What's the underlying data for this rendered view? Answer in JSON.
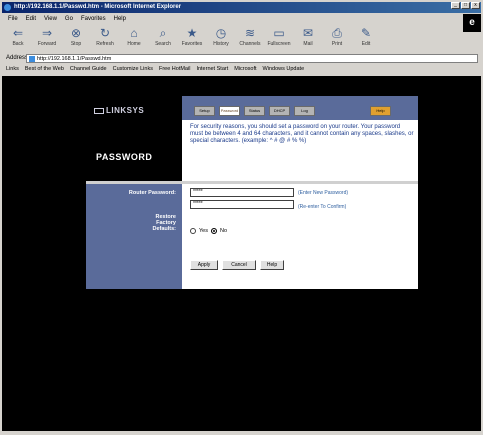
{
  "window": {
    "title": "http://192.168.1.1/Passwd.htm - Microsoft Internet Explorer",
    "controls": [
      "_",
      "□",
      "x"
    ]
  },
  "menu": [
    "File",
    "Edit",
    "View",
    "Go",
    "Favorites",
    "Help"
  ],
  "toolbar": [
    {
      "label": "Back",
      "icon": "back-arrow-icon"
    },
    {
      "label": "Forward",
      "icon": "forward-arrow-icon"
    },
    {
      "label": "Stop",
      "icon": "stop-icon"
    },
    {
      "label": "Refresh",
      "icon": "refresh-icon"
    },
    {
      "label": "Home",
      "icon": "home-icon"
    },
    {
      "label": "Search",
      "icon": "search-icon"
    },
    {
      "label": "Favorites",
      "icon": "favorites-icon"
    },
    {
      "label": "History",
      "icon": "history-icon"
    },
    {
      "label": "Channels",
      "icon": "channels-icon"
    },
    {
      "label": "Fullscreen",
      "icon": "fullscreen-icon"
    },
    {
      "label": "Mail",
      "icon": "mail-icon"
    },
    {
      "label": "Print",
      "icon": "print-icon"
    },
    {
      "label": "Edit",
      "icon": "edit-icon"
    }
  ],
  "address": {
    "label": "Address",
    "value": "http://192.168.1.1/Passwd.htm"
  },
  "links": {
    "label": "Links",
    "items": [
      "Best of the Web",
      "Channel Guide",
      "Customize Links",
      "Free HotMail",
      "Internet Start",
      "Microsoft",
      "Windows Update"
    ]
  },
  "router": {
    "logo": "LINKSYS",
    "section_title": "PASSWORD",
    "tabs": [
      "Setup",
      "Password",
      "Status",
      "DHCP",
      "Log",
      "Help"
    ],
    "active_tab": "Password",
    "info": "For security reasons, you should set a password on your router. Your password must be between 4 and 64 characters, and it cannot contain any spaces, slashes, or special characters. (example: ^ # @ # % %)",
    "labels": {
      "router_password": "Router Password:",
      "restore_factory": "Restore Factory Defaults:"
    },
    "password_value": "*****",
    "confirm_value": "*****",
    "hint_enter": "(Enter New Password)",
    "hint_confirm": "(Re-enter To Confirm)",
    "radio_yes": "Yes",
    "radio_no": "No",
    "buttons": {
      "apply": "Apply",
      "cancel": "Cancel",
      "help": "Help"
    }
  }
}
